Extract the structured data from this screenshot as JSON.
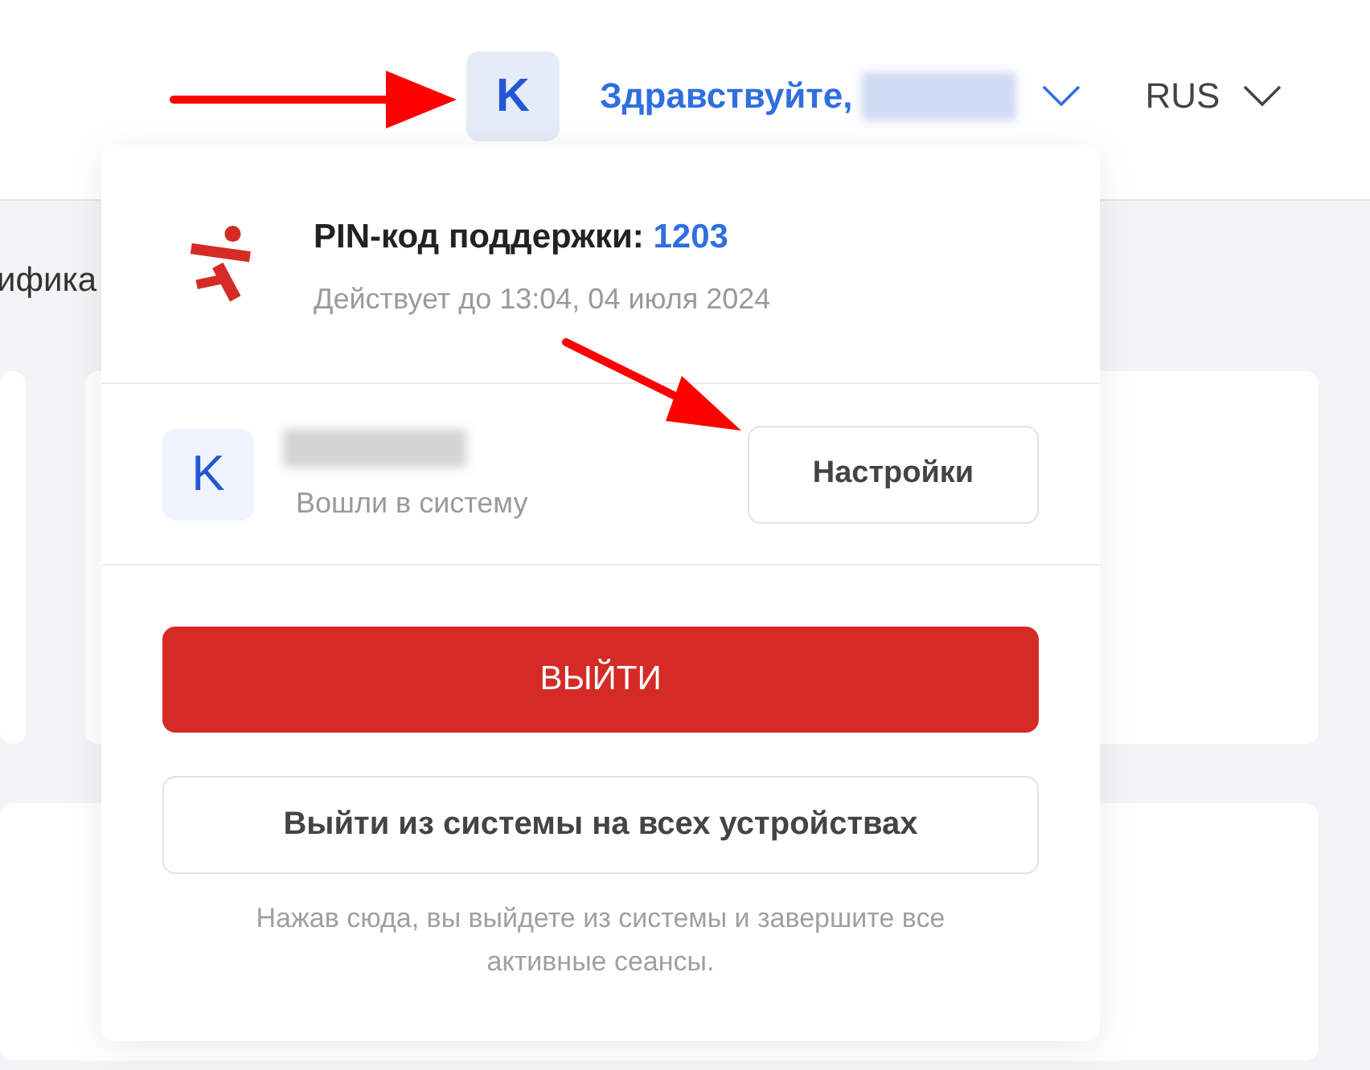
{
  "header": {
    "avatar_letter": "K",
    "greeting": "Здравствуйте,",
    "language": "RUS"
  },
  "background": {
    "tab_fragment": "ифика"
  },
  "popup": {
    "pin_label": "PIN-код поддержки:",
    "pin": "1203",
    "valid_until": "Действует до 13:04, 04 июля 2024",
    "user": {
      "avatar_letter": "K",
      "status": "Вошли в систему"
    },
    "settings_button": "Настройки",
    "logout_button": "ВЫЙТИ",
    "logout_all_button": "Выйти из системы на всех устройствах",
    "note": "Нажав сюда, вы выйдете из системы и завершите все активные сеансы."
  }
}
